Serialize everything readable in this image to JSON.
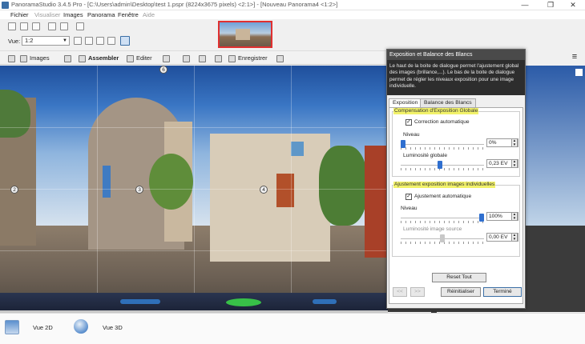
{
  "window": {
    "title": "PanoramaStudio 3.4.5 Pro - [C:\\Users\\admin\\Desktop\\test 1.pspr (8224x3675 pixels) <2:1>] - [Nouveau Panorama4 <1:2>]",
    "minimize": "—",
    "restore": "❐",
    "close": "✕"
  },
  "menu": [
    {
      "label": "Fichier",
      "enabled": true
    },
    {
      "label": "Visualiser",
      "enabled": false
    },
    {
      "label": "Images",
      "enabled": true
    },
    {
      "label": "Panorama",
      "enabled": true
    },
    {
      "label": "Fenêtre",
      "enabled": true
    },
    {
      "label": "Aide",
      "enabled": false
    }
  ],
  "view_selector": {
    "label": "Vue:",
    "value": "1:2"
  },
  "main_toolbar": {
    "images": "Images",
    "assembler": "Assembler",
    "editer": "Editer",
    "enregistrer": "Enregistrer"
  },
  "markers": [
    "2",
    "3",
    "4",
    "6"
  ],
  "dialog": {
    "title": "Exposition et Balance des Blancs",
    "description": "Le haut de la boite de dialogue permet l'ajustement global des images (brillance,...). Le bas de la boite de dialogue permet de régler les niveaux exposition pour une image individuelle.",
    "tabs": [
      "Exposition",
      "Balance des Blancs"
    ],
    "active_tab": 0,
    "global": {
      "title": "Compensation d'Exposition Globale",
      "auto_label": "Correction automatique",
      "auto_checked": true,
      "level_label": "Niveau",
      "level_value": "0%",
      "level_fraction": 0.0,
      "brightness_label": "Luminosité globale",
      "brightness_value": "0,23 EV",
      "brightness_fraction": 0.47
    },
    "individual": {
      "title": "Ajustement exposition images individuelles",
      "auto_label": "Ajustement automatique",
      "auto_checked": true,
      "level_label": "Niveau",
      "level_value": "100%",
      "level_fraction": 1.0,
      "source_label": "Luminosité image source",
      "source_value": "0,00 EV",
      "source_fraction": 0.5
    },
    "reset_all": "Reset Tout",
    "prev": "<<",
    "next": ">>",
    "reinit": "Réinitialiser",
    "done": "Terminé"
  },
  "bottom": {
    "view2d": "Vue 2D",
    "view3d": "Vue 3D"
  },
  "colors": {
    "accent": "#3a6ea5",
    "highlight": "#f2f26a",
    "slider": "#2f6fcf",
    "selection_border": "#e03030"
  }
}
